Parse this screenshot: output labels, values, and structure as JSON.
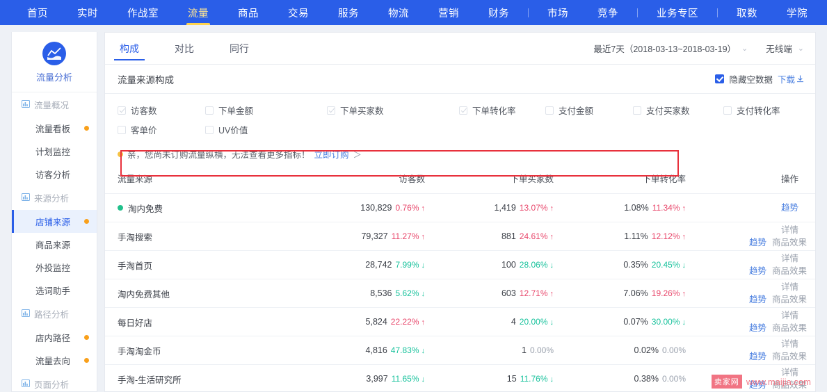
{
  "topnav": {
    "items": [
      {
        "label": "首页",
        "active": false,
        "sep_after": false
      },
      {
        "label": "实时",
        "active": false,
        "sep_after": false
      },
      {
        "label": "作战室",
        "active": false,
        "sep_after": false
      },
      {
        "label": "流量",
        "active": true,
        "sep_after": false
      },
      {
        "label": "商品",
        "active": false,
        "sep_after": false
      },
      {
        "label": "交易",
        "active": false,
        "sep_after": false
      },
      {
        "label": "服务",
        "active": false,
        "sep_after": false
      },
      {
        "label": "物流",
        "active": false,
        "sep_after": false
      },
      {
        "label": "营销",
        "active": false,
        "sep_after": false
      },
      {
        "label": "财务",
        "active": false,
        "sep_after": true
      },
      {
        "label": "市场",
        "active": false,
        "sep_after": false
      },
      {
        "label": "竞争",
        "active": false,
        "sep_after": true
      },
      {
        "label": "业务专区",
        "active": false,
        "sep_after": true
      },
      {
        "label": "取数",
        "active": false,
        "sep_after": false
      },
      {
        "label": "学院",
        "active": false,
        "sep_after": false
      }
    ]
  },
  "sidebar": {
    "app_title": "流量分析",
    "items": [
      {
        "label": "流量概况",
        "type": "group",
        "active": false,
        "dot": false
      },
      {
        "label": "流量看板",
        "type": "item",
        "active": false,
        "dot": true
      },
      {
        "label": "计划监控",
        "type": "item",
        "active": false,
        "dot": false
      },
      {
        "label": "访客分析",
        "type": "item",
        "active": false,
        "dot": false
      },
      {
        "label": "来源分析",
        "type": "group",
        "active": false,
        "dot": false
      },
      {
        "label": "店铺来源",
        "type": "item",
        "active": true,
        "dot": true
      },
      {
        "label": "商品来源",
        "type": "item",
        "active": false,
        "dot": false
      },
      {
        "label": "外投监控",
        "type": "item",
        "active": false,
        "dot": false
      },
      {
        "label": "选词助手",
        "type": "item",
        "active": false,
        "dot": false
      },
      {
        "label": "路径分析",
        "type": "group",
        "active": false,
        "dot": false
      },
      {
        "label": "店内路径",
        "type": "item",
        "active": false,
        "dot": true
      },
      {
        "label": "流量去向",
        "type": "item",
        "active": false,
        "dot": true
      },
      {
        "label": "页面分析",
        "type": "group",
        "active": false,
        "dot": false
      }
    ]
  },
  "tabs": [
    {
      "label": "构成",
      "active": true
    },
    {
      "label": "对比",
      "active": false
    },
    {
      "label": "同行",
      "active": false
    }
  ],
  "filters": {
    "date_range": "最近7天（2018-03-13~2018-03-19）",
    "terminal": "无线端",
    "caret": "⌄"
  },
  "panel": {
    "title": "流量来源构成",
    "hide_empty_label": "隐藏空数据",
    "hide_empty_checked": true,
    "download_label": "下载",
    "download_icon": "download-arrow-icon"
  },
  "metrics": [
    {
      "label": "访客数",
      "checked": true
    },
    {
      "label": "下单金额",
      "checked": false
    },
    {
      "label": "下单买家数",
      "checked": true
    },
    {
      "label": "下单转化率",
      "checked": true
    },
    {
      "label": "支付金额",
      "checked": false
    },
    {
      "label": "支付买家数",
      "checked": false
    },
    {
      "label": "支付转化率",
      "checked": false
    },
    {
      "label": "客单价",
      "checked": false
    },
    {
      "label": "UV价值",
      "checked": false
    }
  ],
  "notice": {
    "text": "亲，您尚未订购流量纵横，无法查看更多指标！",
    "link": "立即订购",
    "arrow": "＞"
  },
  "table": {
    "headers": [
      "流量来源",
      "访客数",
      "下单买家数",
      "下单转化率",
      "操作"
    ],
    "actions": {
      "detail": "详情",
      "trend": "趋势",
      "product_effect": "商品效果"
    },
    "rows": [
      {
        "name": "淘内免费",
        "dot": true,
        "highlight": false,
        "visitors": "130,829",
        "visitors_pct": "0.76%",
        "visitors_dir": "up",
        "buyers": "1,419",
        "buyers_pct": "13.07%",
        "buyers_dir": "up",
        "conv": "1.08%",
        "conv_pct": "11.34%",
        "conv_dir": "up",
        "actions_mode": "trend-only"
      },
      {
        "name": "手淘搜索",
        "dot": false,
        "highlight": true,
        "visitors": "79,327",
        "visitors_pct": "11.27%",
        "visitors_dir": "up",
        "buyers": "881",
        "buyers_pct": "24.61%",
        "buyers_dir": "up",
        "conv": "1.11%",
        "conv_pct": "12.12%",
        "conv_dir": "up",
        "actions_mode": "full"
      },
      {
        "name": "手淘首页",
        "dot": false,
        "highlight": false,
        "visitors": "28,742",
        "visitors_pct": "7.99%",
        "visitors_dir": "dn",
        "buyers": "100",
        "buyers_pct": "28.06%",
        "buyers_dir": "dn",
        "conv": "0.35%",
        "conv_pct": "20.45%",
        "conv_dir": "dn",
        "actions_mode": "full"
      },
      {
        "name": "淘内免费其他",
        "dot": false,
        "highlight": false,
        "visitors": "8,536",
        "visitors_pct": "5.62%",
        "visitors_dir": "dn",
        "buyers": "603",
        "buyers_pct": "12.71%",
        "buyers_dir": "up",
        "conv": "7.06%",
        "conv_pct": "19.26%",
        "conv_dir": "up",
        "actions_mode": "full"
      },
      {
        "name": "每日好店",
        "dot": false,
        "highlight": false,
        "visitors": "5,824",
        "visitors_pct": "22.22%",
        "visitors_dir": "up",
        "buyers": "4",
        "buyers_pct": "20.00%",
        "buyers_dir": "dn",
        "conv": "0.07%",
        "conv_pct": "30.00%",
        "conv_dir": "dn",
        "actions_mode": "full"
      },
      {
        "name": "手淘淘金币",
        "dot": false,
        "highlight": false,
        "visitors": "4,816",
        "visitors_pct": "47.83%",
        "visitors_dir": "dn",
        "buyers": "1",
        "buyers_pct": "0.00%",
        "buyers_dir": "flat",
        "conv": "0.02%",
        "conv_pct": "0.00%",
        "conv_dir": "flat",
        "actions_mode": "full"
      },
      {
        "name": "手淘-生活研究所",
        "dot": false,
        "highlight": false,
        "visitors": "3,997",
        "visitors_pct": "11.65%",
        "visitors_dir": "dn",
        "buyers": "15",
        "buyers_pct": "11.76%",
        "buyers_dir": "dn",
        "conv": "0.38%",
        "conv_pct": "0.00%",
        "conv_dir": "flat",
        "actions_mode": "full"
      }
    ]
  },
  "watermark": {
    "badge": "卖家网",
    "url": "www.maijia.com"
  },
  "colors": {
    "brand_blue": "#2a5ee8",
    "accent_yellow": "#ffd34e",
    "up_red": "#e8476b",
    "down_green": "#18c29c",
    "highlight_red": "#e8313c",
    "dot_orange": "#f9a01b",
    "dot_green": "#21c08b"
  }
}
